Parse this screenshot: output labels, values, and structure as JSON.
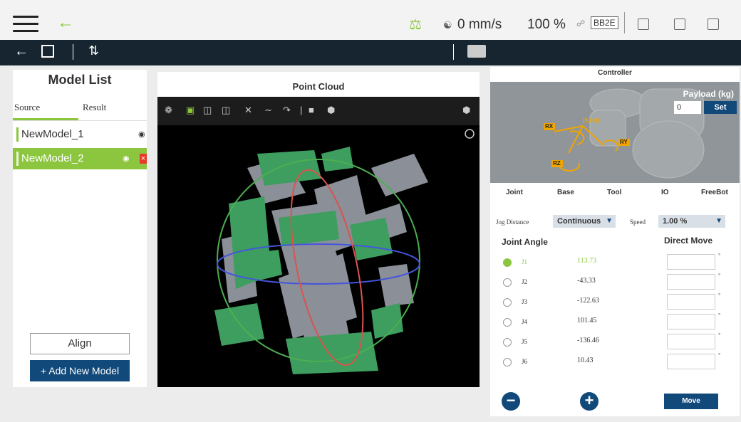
{
  "topbar": {
    "speed": "0 mm/s",
    "percent": "100 %",
    "device": "BB2E"
  },
  "model_list": {
    "title": "Model List",
    "tabs": [
      "Source",
      "Result"
    ],
    "items": [
      "NewModel_1",
      "NewModel_2"
    ],
    "selected_index": 1,
    "align_label": "Align",
    "add_label": "+ Add New Model"
  },
  "point_cloud": {
    "title": "Point Cloud"
  },
  "controller": {
    "title": "Controller",
    "payload_label": "Payload (kg)",
    "payload_value": "0",
    "set_label": "Set",
    "axes": [
      "RX",
      "RY",
      "RZ"
    ],
    "origin": "(0,0,0)",
    "tabs": [
      "Joint",
      "Base",
      "Tool",
      "IO",
      "FreeBot"
    ],
    "jog_distance_label": "Jog Distance",
    "jog_distance_value": "Continuous",
    "speed_label": "Speed",
    "speed_value": "1.00 %",
    "joint_angle_title": "Joint Angle",
    "direct_move_title": "Direct Move",
    "joints": [
      {
        "name": "J1",
        "value": "113.73"
      },
      {
        "name": "J2",
        "value": "-43.33"
      },
      {
        "name": "J3",
        "value": "-122.63"
      },
      {
        "name": "J4",
        "value": "101.45"
      },
      {
        "name": "J5",
        "value": "-136.46"
      },
      {
        "name": "J6",
        "value": "10.43"
      }
    ],
    "selected_joint": 0,
    "move_label": "Move",
    "degree_symbol": "°"
  },
  "colors": {
    "accent_green": "#8cc63e",
    "dark_bar": "#16252f",
    "button_blue": "#10497a",
    "delete_red": "#e8392b"
  }
}
